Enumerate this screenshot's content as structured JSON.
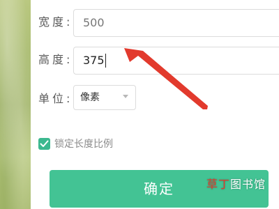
{
  "form": {
    "width_label": "宽度:",
    "width_value": "500",
    "height_label": "高度:",
    "height_value": "375",
    "unit_label": "单位:",
    "unit_value": "像素",
    "lock_ratio_label": "锁定长度比例",
    "lock_ratio_checked": true,
    "confirm_label": "确定"
  },
  "overlay": {
    "watermark_part1": "草丁",
    "watermark_part2": "图书馆"
  },
  "colors": {
    "accent": "#43c394",
    "checkbox": "#3cb88f",
    "arrow": "#e23a2d"
  },
  "icons": {
    "arrow": "annotation-arrow-icon",
    "check": "checkmark-icon",
    "dropdown": "chevron-down-icon"
  }
}
